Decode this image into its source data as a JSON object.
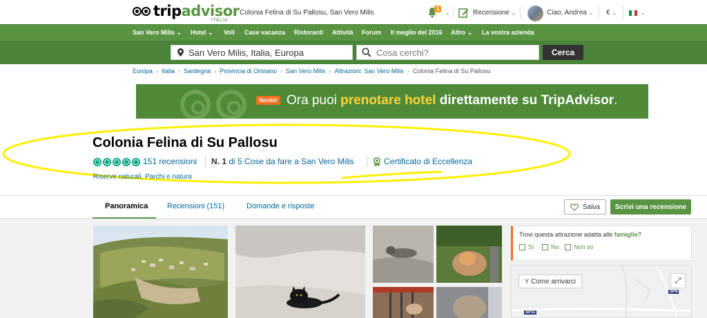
{
  "header": {
    "logo_trip": "trip",
    "logo_advisor": "advisor",
    "logo_sub": "ITALIA",
    "page_title": "Colonia Felina di Su Pallosu, San Vero Milis",
    "notif_count": "1",
    "review_label": "Recensione",
    "greeting": "Ciao, Andrea",
    "currency": "€"
  },
  "nav": {
    "items": [
      "San Vero Milis",
      "Hotel",
      "Voli",
      "Case vacanza",
      "Ristoranti",
      "Attività",
      "Forum",
      "Il meglio del 2016",
      "Altro",
      "La vostra azienda"
    ]
  },
  "search": {
    "location_value": "San Vero Milis, Italia, Europa",
    "query_placeholder": "Cosa cerchi?",
    "button": "Cerca"
  },
  "breadcrumb": [
    "Europa",
    "Italia",
    "Sardegna",
    "Provincia di Oristano",
    "San Vero Milis",
    "Attrazioni: San Vero Milis",
    "Colonia Felina di Su Pallosu"
  ],
  "banner": {
    "badge": "Novità!",
    "text_before": "Ora puoi ",
    "text_highlight": "prenotare hotel",
    "text_after": " direttamente su TripAdvisor",
    "text_end": "."
  },
  "attraction": {
    "title": "Colonia Felina di Su Pallosu",
    "rating": 5,
    "reviews": "151 recensioni",
    "rank_num": "N. 1",
    "rank_text": " di 5 Cose da fare a San Vero Milis",
    "certificate": "Certificato di Eccellenza",
    "categories": "Riserve naturali, Parchi e natura"
  },
  "tabs": {
    "overview": "Panoramica",
    "reviews": "Recensioni (151)",
    "qa": "Domande e risposte",
    "save": "Salva",
    "write": "Scrivi una recensione"
  },
  "family": {
    "question": "Trovi questa attrazione adatta alle ",
    "highlight": "famiglie",
    "end": "?",
    "opt_yes": "Sì",
    "opt_no": "No",
    "opt_unsure": "Non so"
  },
  "map": {
    "directions": "Come arrivarci",
    "road_sp11": "SP11",
    "road_sp9": "SP9"
  },
  "colors": {
    "brand_green": "#589442",
    "accent_orange": "#f06f1f",
    "link_blue": "#069"
  }
}
